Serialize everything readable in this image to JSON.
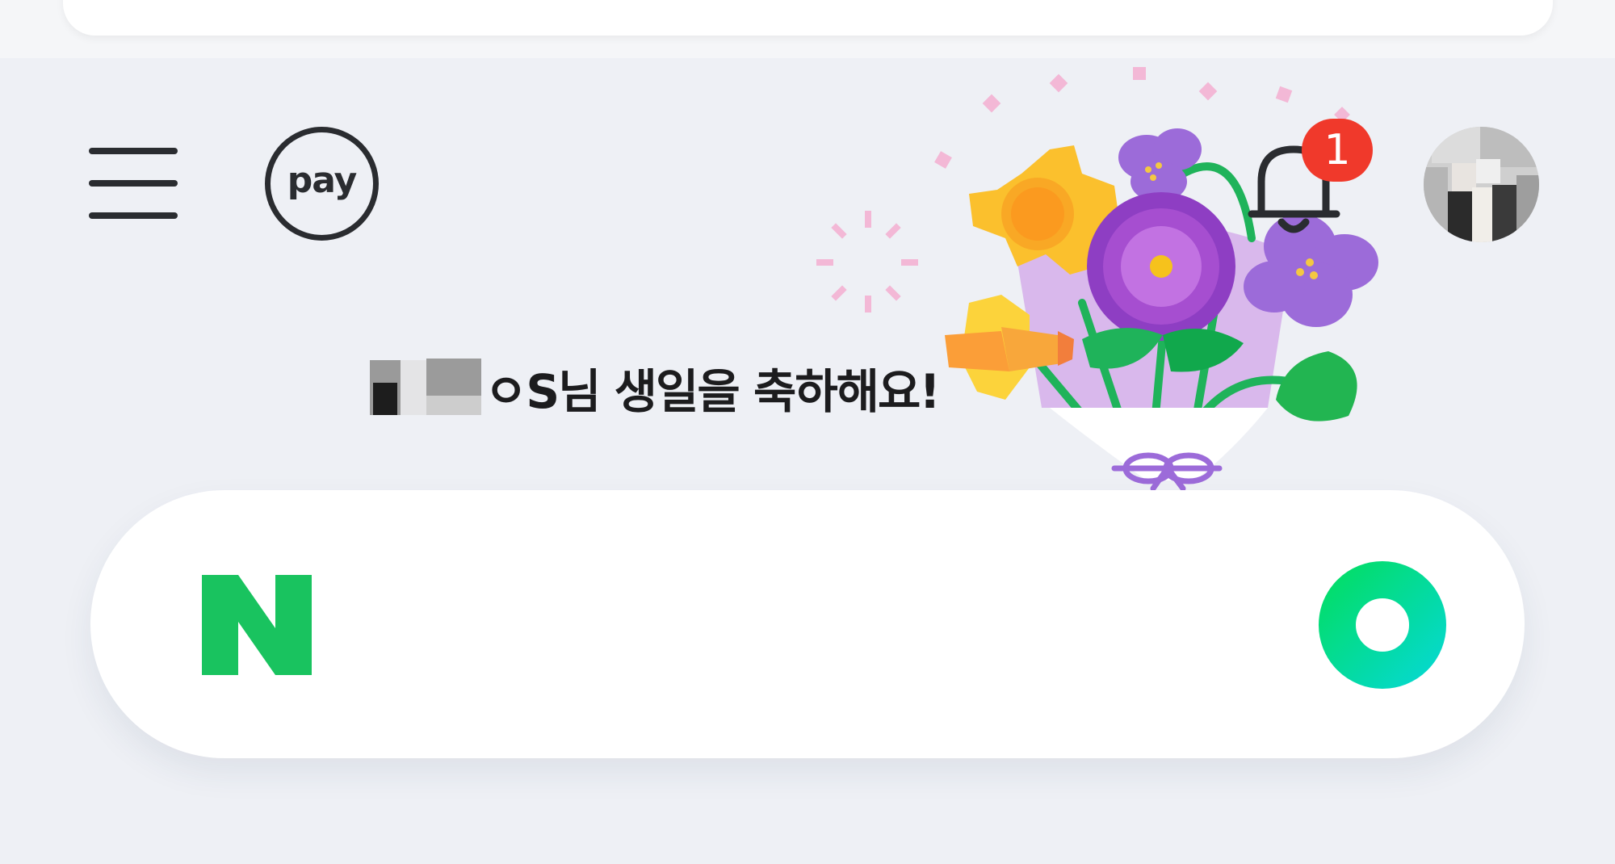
{
  "header": {
    "pay_label": "pay",
    "notification_count": "1",
    "menu_icon": "hamburger-menu-icon",
    "bell_icon": "bell-icon"
  },
  "greeting": {
    "text": "ㅇS님 생일을 축하해요!"
  },
  "search": {
    "brand_letter": "N",
    "value": "",
    "action_icon": "green-ring-icon"
  },
  "colors": {
    "background": "#eef0f5",
    "brand_green": "#19c35f",
    "badge_red": "#f0392b",
    "search_button_green": "#03dd6d"
  }
}
